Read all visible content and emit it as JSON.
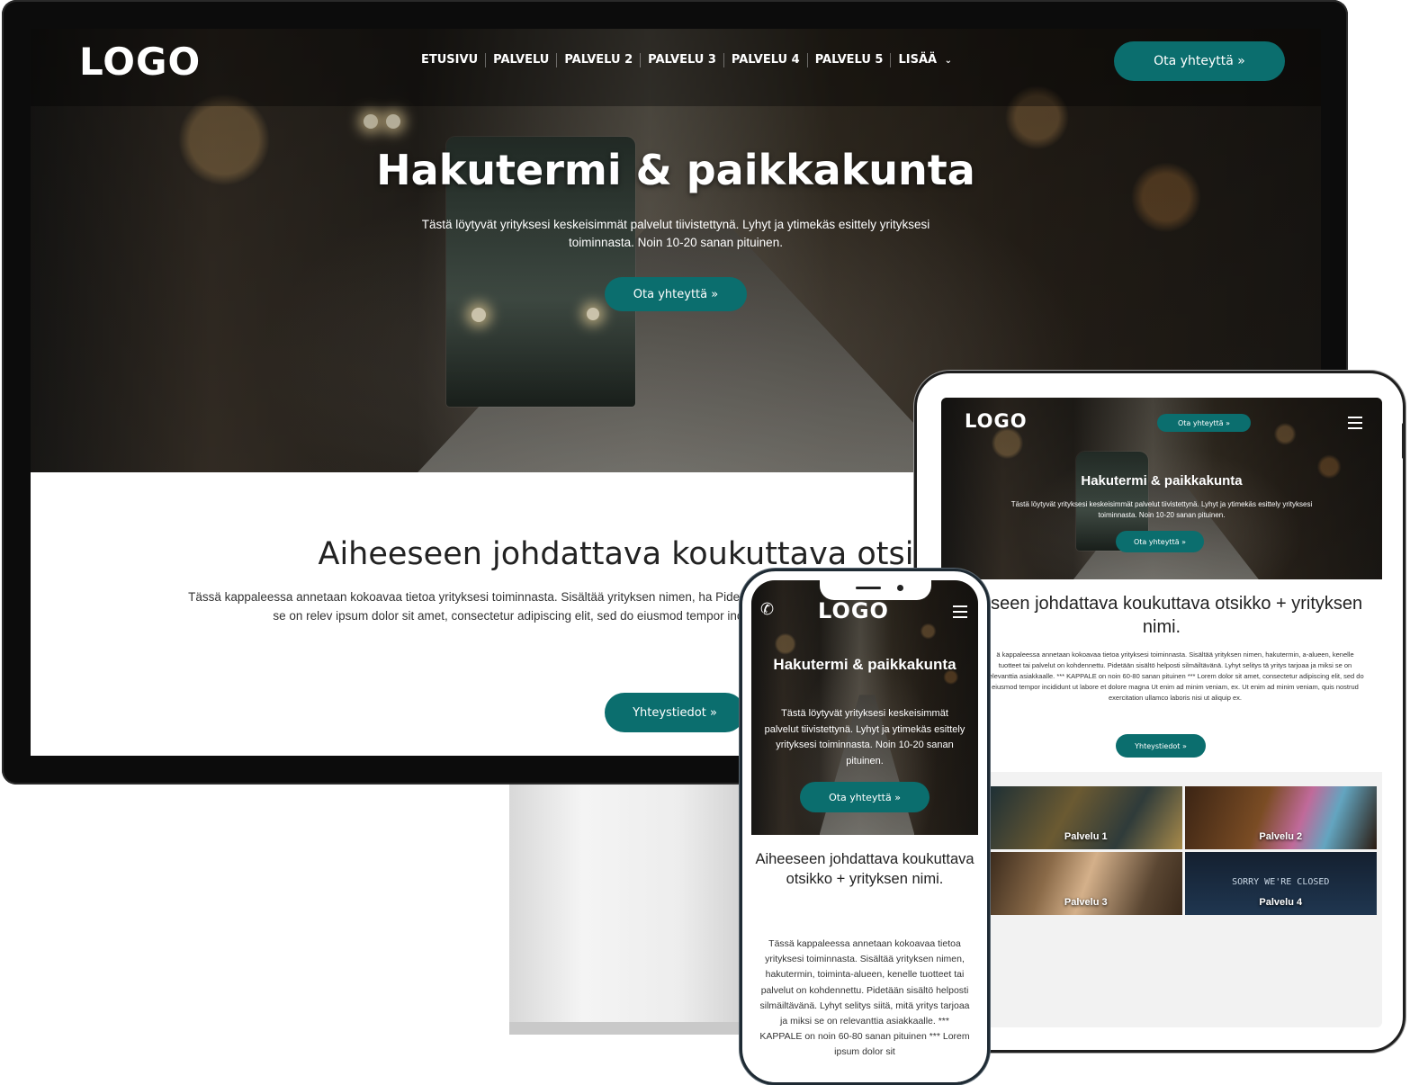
{
  "brand": {
    "accent": "#0b6e6e",
    "logo": "LOGO"
  },
  "desktop": {
    "nav": {
      "items": [
        "ETUSIVU",
        "PALVELU",
        "PALVELU 2",
        "PALVELU 3",
        "PALVELU 4",
        "PALVELU 5",
        "LISÄÄ"
      ],
      "more_icon": "chevron-down-icon",
      "cta": "Ota yhteyttä »"
    },
    "hero": {
      "title": "Hakutermi & paikkakunta",
      "subtitle": "Tästä löytyvät yrityksesi keskeisimmät palvelut tiivistettynä. Lyhyt ja ytimekäs esittely yrityksesi toiminnasta. Noin 10-20 sanan pituinen.",
      "cta": "Ota yhteyttä »"
    },
    "intro": {
      "heading": "Aiheeseen johdattava koukuttava otsikko + y",
      "paragraph": "Tässä kappaleessa annetaan kokoavaa tietoa yrityksesi toiminnasta. Sisältää yrityksen nimen, ha Pidetään sisältö helposti silmäiltävänä. Lyhyt selitys siitä, mitä yritys tarjoaa ja miksi se on relev ipsum dolor sit amet, consectetur adipiscing elit, sed do eiusmod tempor incididunt ut labore e veniam, quis nostrud exercitation ullamco la",
      "cta": "Yhteystiedot »"
    }
  },
  "tablet": {
    "nav": {
      "cta": "Ota yhteyttä »",
      "menu_icon": "hamburger-menu-icon"
    },
    "hero": {
      "title": "Hakutermi & paikkakunta",
      "subtitle": "Tästä löytyvät yrityksesi keskeisimmät palvelut tiivistettynä. Lyhyt ja ytimekäs esittely yrityksesi toiminnasta. Noin 10-20 sanan pituinen.",
      "cta": "Ota yhteyttä »"
    },
    "intro": {
      "heading": "heeseen johdattava koukuttava otsikko + yrityksen nimi.",
      "paragraph": "ä kappaleessa annetaan kokoavaa tietoa yrityksesi toiminnasta. Sisältää yrityksen nimen, hakutermin, a-alueen, kenelle tuotteet tai palvelut on kohdennettu. Pidetään sisältö helposti silmäiltävänä. Lyhyt selitys tä yritys tarjoaa ja miksi se on relevanttia asiakkaalle. *** KAPPALE on noin 60-80 sanan pituinen *** Lorem dolor sit amet, consectetur adipiscing elit, sed do eiusmod tempor incididunt ut labore et dolore magna Ut enim ad minim veniam, ex. Ut enim ad minim veniam, quis nostrud exercitation ullamco laboris nisi ut aliquip ex.",
      "cta": "Yhteystiedot »"
    },
    "services": [
      {
        "label": "Palvelu 1"
      },
      {
        "label": "Palvelu 2"
      },
      {
        "label": "Palvelu 3"
      },
      {
        "label": "Palvelu 4",
        "sign": "SORRY WE'RE CLOSED"
      }
    ]
  },
  "phone": {
    "nav": {
      "call_icon": "phone-icon",
      "menu_icon": "hamburger-menu-icon"
    },
    "hero": {
      "title": "Hakutermi & paikkakunta",
      "subtitle": "Tästä löytyvät yrityksesi keskeisimmät palvelut tiivistettynä. Lyhyt ja ytimekäs esittely yrityksesi toiminnasta. Noin 10-20 sanan pituinen.",
      "cta": "Ota yhteyttä »"
    },
    "intro": {
      "heading": "Aiheeseen johdattava koukuttava otsikko + yrityksen nimi.",
      "paragraph": "Tässä kappaleessa annetaan kokoavaa tietoa yrityksesi toiminnasta. Sisältää yrityksen nimen, hakutermin, toiminta-alueen, kenelle tuotteet tai palvelut on kohdennettu. Pidetään sisältö helposti silmäiltävänä. Lyhyt selitys siitä, mitä yritys tarjoaa ja miksi se on relevanttia asiakkaalle. *** KAPPALE on noin 60-80 sanan pituinen *** Lorem ipsum dolor sit"
    }
  }
}
